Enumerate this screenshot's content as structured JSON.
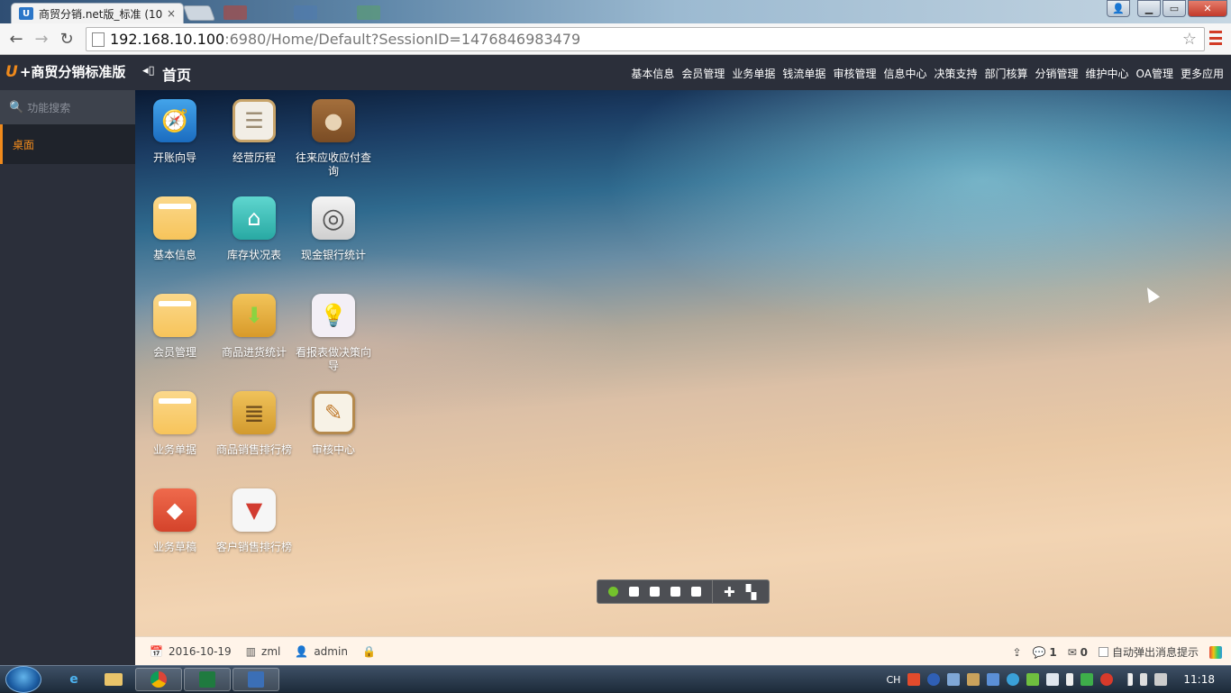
{
  "browser": {
    "tab_title": "商贸分销.net版_标准 (10(",
    "tab_favicon": "U",
    "close_glyph": "×",
    "url_host": "192.168.10.100",
    "url_path": ":6980/Home/Default?SessionID=1476846983479",
    "star_glyph": "☆",
    "back_glyph": "←",
    "forward_glyph": "→",
    "reload_glyph": "↻"
  },
  "window_controls": {
    "user_glyph": "👤",
    "minimize": "▁",
    "maximize": "▭",
    "close": "✕"
  },
  "header": {
    "brand_u": "U",
    "brand": "+商贸分销标准版",
    "home_icon": "◂▯",
    "title": "首页",
    "nav": [
      "基本信息",
      "会员管理",
      "业务单据",
      "钱流单据",
      "审核管理",
      "信息中心",
      "决策支持",
      "部门核算",
      "分销管理",
      "维护中心",
      "OA管理",
      "更多应用"
    ]
  },
  "sidebar": {
    "search_icon": "🔍",
    "search_placeholder": "功能搜索",
    "items": [
      {
        "label": "桌面"
      }
    ]
  },
  "desktop": {
    "apps": [
      {
        "label": "开账向导",
        "icon": "compass-icon",
        "glyph": "🧭",
        "color": "#2f8fdc"
      },
      {
        "label": "经营历程",
        "icon": "notebook-icon",
        "glyph": "☰",
        "color": "#f2eee6"
      },
      {
        "label": "往来应收应付查询",
        "icon": "wallet-icon",
        "glyph": "●",
        "color": "#8a5a2f"
      },
      {
        "label": "基本信息",
        "icon": "folder-icon",
        "glyph": "",
        "color": "#f7c45b"
      },
      {
        "label": "库存状况表",
        "icon": "house-icon",
        "glyph": "⌂",
        "color": "#3cc2bd"
      },
      {
        "label": "现金银行统计",
        "icon": "safe-dial-icon",
        "glyph": "◎",
        "color": "#e6e6e6"
      },
      {
        "label": "会员管理",
        "icon": "folder-icon",
        "glyph": "",
        "color": "#f7c45b"
      },
      {
        "label": "商品进货统计",
        "icon": "download-box-icon",
        "glyph": "⬇",
        "color": "#e8b33e"
      },
      {
        "label": "看报表做决策向导",
        "icon": "lightbulb-icon",
        "glyph": "💡",
        "color": "#f0ecf3"
      },
      {
        "label": "业务单据",
        "icon": "folder-icon",
        "glyph": "",
        "color": "#f7c45b"
      },
      {
        "label": "商品销售排行榜",
        "icon": "ranking-list-icon",
        "glyph": "≣",
        "color": "#e7b040"
      },
      {
        "label": "审核中心",
        "icon": "checklist-pen-icon",
        "glyph": "✎",
        "color": "#f6f1e4"
      },
      {
        "label": "业务草稿",
        "icon": "eraser-icon",
        "glyph": "◆",
        "color": "#e6533a"
      },
      {
        "label": "客户销售排行榜",
        "icon": "tie-chart-icon",
        "glyph": "▼",
        "color": "#f5f5f5"
      }
    ],
    "page_dots": 5,
    "active_dot": 0,
    "add_glyph": "✚",
    "grid_glyph": "▚"
  },
  "status": {
    "date_icon": "📅",
    "date": "2016-10-19",
    "shop_icon": "▥",
    "shop": "zml",
    "user_icon": "👤",
    "user": "admin",
    "lock_icon": "🔒",
    "upload_icon": "⇪",
    "chat_icon": "💬",
    "chat_count": "1",
    "mail_icon": "✉",
    "mail_count": "0",
    "auto_popup_label": "自动弹出消息提示"
  },
  "taskbar": {
    "ime": "CH",
    "clock": "11:18"
  }
}
